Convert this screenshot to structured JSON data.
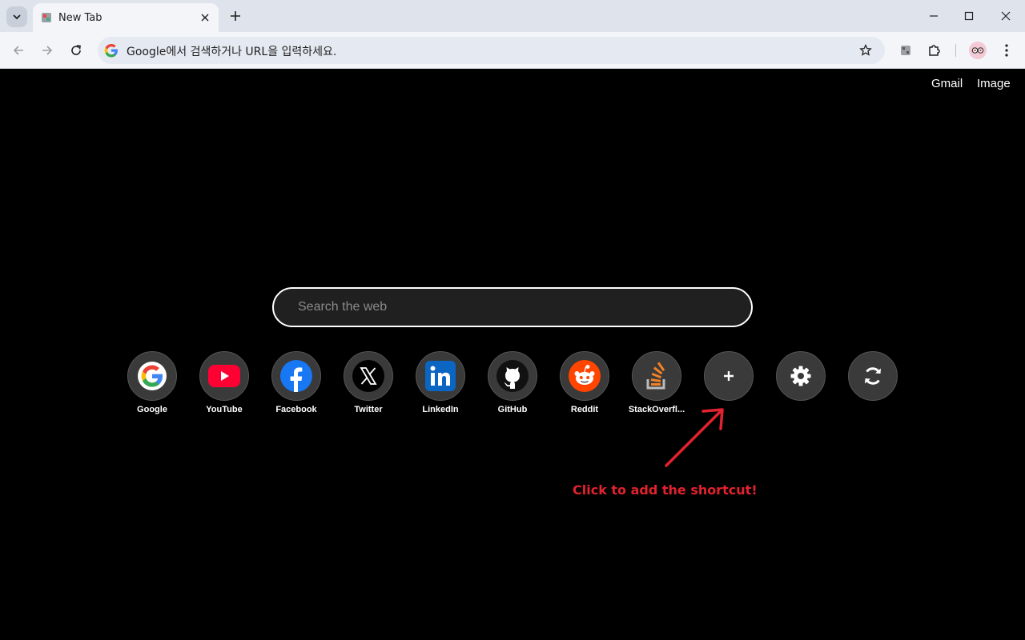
{
  "browser": {
    "tab_title": "New Tab",
    "omnibox_text": "Google에서 검색하거나 URL을 입력하세요."
  },
  "page": {
    "top_links": [
      "Gmail",
      "Image"
    ],
    "search_placeholder": "Search the web",
    "shortcuts": [
      {
        "label": "Google",
        "icon": "google-icon"
      },
      {
        "label": "YouTube",
        "icon": "youtube-icon"
      },
      {
        "label": "Facebook",
        "icon": "facebook-icon"
      },
      {
        "label": "Twitter",
        "icon": "x-icon"
      },
      {
        "label": "LinkedIn",
        "icon": "linkedin-icon"
      },
      {
        "label": "GitHub",
        "icon": "github-icon"
      },
      {
        "label": "Reddit",
        "icon": "reddit-icon"
      },
      {
        "label": "StackOverfl...",
        "icon": "stackoverflow-icon"
      }
    ],
    "actions": [
      {
        "icon": "plus-icon"
      },
      {
        "icon": "gear-icon"
      },
      {
        "icon": "sync-icon"
      }
    ],
    "annotation": "Click to add the shortcut!"
  },
  "colors": {
    "annotation": "#e2222e",
    "page_bg": "#000000",
    "shortcut_circle": "#3a3a3a"
  }
}
